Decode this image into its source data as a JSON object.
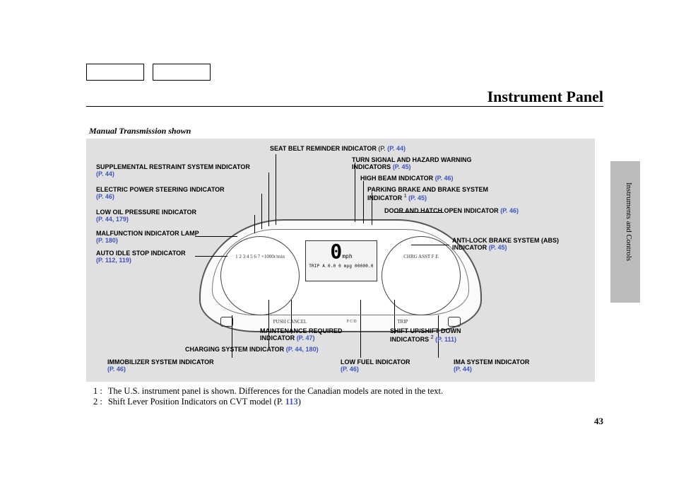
{
  "title": "Instrument Panel",
  "caption": "Manual Transmission shown",
  "section_tab": "Instruments and Controls",
  "page_number": "43",
  "cluster": {
    "speed_value": "0",
    "speed_unit": "mph",
    "trip_label": "TRIP A",
    "trip_readout": "0.0 0 mpg 00000.0",
    "dial_left": "1 2 3 4 5 6 7 ×1000r/min",
    "dial_right": "CHRG ASST F E",
    "fcd": "FCD",
    "button_left": "PUSH CANCEL",
    "button_right": "TRIP"
  },
  "labels": {
    "seatbelt": {
      "text": "SEAT BELT REMINDER INDICATOR",
      "page": "(P. 44)"
    },
    "srs": {
      "text": "SUPPLEMENTAL RESTRAINT SYSTEM INDICATOR",
      "page": "(P. 44)"
    },
    "eps": {
      "text": "ELECTRIC POWER STEERING INDICATOR",
      "page": "(P. 46)"
    },
    "lowoil": {
      "text": "LOW OIL PRESSURE INDICATOR",
      "page": "(P. 44, 179)"
    },
    "mil": {
      "text": "MALFUNCTION INDICATOR LAMP",
      "page": "(P. 180)"
    },
    "idlestop": {
      "text": "AUTO IDLE STOP INDICATOR",
      "page": "(P. 112, 119)"
    },
    "turn": {
      "text": "TURN SIGNAL AND HAZARD WARNING INDICATORS",
      "page": "(P. 45)"
    },
    "highbeam": {
      "text": "HIGH BEAM INDICATOR",
      "page": "(P. 46)"
    },
    "brake": {
      "text": "PARKING BRAKE AND BRAKE SYSTEM INDICATOR",
      "sup": "1",
      "page": "(P. 45)"
    },
    "door": {
      "text": "DOOR AND HATCH OPEN INDICATOR",
      "page": "(P. 46)"
    },
    "abs": {
      "text": "ANTI-LOCK BRAKE SYSTEM (ABS) INDICATOR",
      "page": "(P. 45)"
    },
    "maint": {
      "text": "MAINTENANCE REQUIRED INDICATOR",
      "page": "(P. 47)"
    },
    "charge": {
      "text": "CHARGING SYSTEM INDICATOR",
      "page": "(P. 44, 180)"
    },
    "immob": {
      "text": "IMMOBILIZER SYSTEM INDICATOR",
      "page": "(P. 46)"
    },
    "lowfuel": {
      "text": "LOW FUEL INDICATOR",
      "page": "(P. 46)"
    },
    "shift": {
      "text": "SHIFT UP/SHIFT DOWN INDICATORS",
      "sup": "2",
      "page": "(P. 111)"
    },
    "ima": {
      "text": "IMA SYSTEM INDICATOR",
      "page": "(P. 44)"
    }
  },
  "footnotes": {
    "n1_key": "1 :",
    "n1_text": "The U.S. instrument panel is shown. Differences for the Canadian models are noted in the text.",
    "n2_key": "2 :",
    "n2_text_a": "Shift Lever Position Indicators on CVT model (P. ",
    "n2_page": "113",
    "n2_text_b": ")"
  }
}
